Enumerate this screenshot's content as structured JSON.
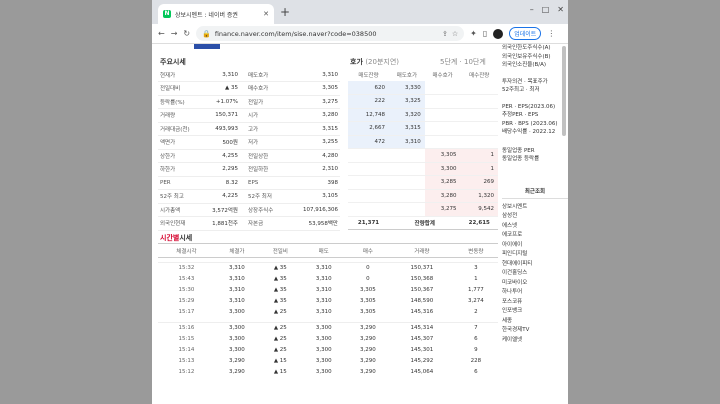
{
  "browser": {
    "tab_title": "상보시멘트 : 네이버 증권",
    "url": "finance.naver.com/item/sise.naver?code=038500",
    "update_label": "업데이트"
  },
  "quote_section": {
    "title": "주요시세",
    "rows": [
      {
        "l1": "현재가",
        "v1": "3,310",
        "c1": "",
        "l2": "매도호가",
        "v2": "3,310"
      },
      {
        "l1": "전일대비",
        "v1": "▲ 35",
        "c1": "red",
        "l2": "매수호가",
        "v2": "3,305"
      },
      {
        "l1": "등락률(%)",
        "v1": "+1.07%",
        "c1": "red",
        "l2": "전일가",
        "v2": "3,275"
      },
      {
        "l1": "거래량",
        "v1": "150,371",
        "c1": "",
        "l2": "시가",
        "v2": "3,280"
      },
      {
        "l1": "거래대금(천)",
        "v1": "493,993",
        "c1": "",
        "l2": "고가",
        "v2": "3,315"
      },
      {
        "l1": "액면가",
        "v1": "500원",
        "c1": "",
        "l2": "저가",
        "v2": "3,255"
      },
      {
        "l1": "상한가",
        "v1": "4,255",
        "c1": "",
        "l2": "전일상한",
        "v2": "4,280"
      },
      {
        "l1": "하한가",
        "v1": "2,295",
        "c1": "",
        "l2": "전일하한",
        "v2": "2,310"
      },
      {
        "l1": "PER",
        "v1": "8.32",
        "c1": "",
        "l2": "EPS",
        "v2": "398"
      },
      {
        "l1": "52주 최고",
        "v1": "4,225",
        "c1": "",
        "l2": "52주 최저",
        "v2": "3,105"
      },
      {
        "l1": "시가총액",
        "v1": "3,572억원",
        "c1": "",
        "l2": "상장주식수",
        "v2": "107,916,306"
      },
      {
        "l1": "외국인현재",
        "v1": "1,881천주",
        "c1": "",
        "l2": "자본금",
        "v2": "53,958백만"
      }
    ]
  },
  "hoga_section": {
    "title": "호가",
    "subtitle": "(20분지연)",
    "step_label": "5단계 · 10단계",
    "headers": [
      "매도잔량",
      "매도호가",
      "매수호가",
      "매수잔량"
    ],
    "asks": [
      {
        "qty": "620",
        "price": "3,330"
      },
      {
        "qty": "222",
        "price": "3,325"
      },
      {
        "qty": "12,748",
        "price": "3,320"
      },
      {
        "qty": "2,667",
        "price": "3,315"
      },
      {
        "qty": "472",
        "price": "3,310"
      }
    ],
    "bids": [
      {
        "price": "3,305",
        "qty": "1"
      },
      {
        "price": "3,300",
        "qty": "1"
      },
      {
        "price": "3,285",
        "qty": "269"
      },
      {
        "price": "3,280",
        "qty": "1,320"
      },
      {
        "price": "3,275",
        "qty": "9,542"
      }
    ],
    "sum_ask": "21,371",
    "sum_label": "잔량합계",
    "sum_bid": "22,615"
  },
  "time_section": {
    "title_red": "시간별",
    "title": "시세",
    "headers": [
      "체결시각",
      "체결가",
      "전일비",
      "매도",
      "매수",
      "거래량",
      "변동량"
    ],
    "groups": [
      [
        {
          "t": "15:32",
          "p": "3,310",
          "d": "▲ 35",
          "s": "3,310",
          "b": "0",
          "v": "150,371",
          "c": "3"
        },
        {
          "t": "15:43",
          "p": "3,310",
          "d": "▲ 35",
          "s": "3,310",
          "b": "0",
          "v": "150,368",
          "c": "1"
        },
        {
          "t": "15:30",
          "p": "3,310",
          "d": "▲ 35",
          "s": "3,310",
          "b": "3,305",
          "v": "150,367",
          "c": "1,777"
        },
        {
          "t": "15:29",
          "p": "3,310",
          "d": "▲ 35",
          "s": "3,310",
          "b": "3,305",
          "v": "148,590",
          "c": "3,274"
        },
        {
          "t": "15:17",
          "p": "3,300",
          "d": "▲ 25",
          "s": "3,310",
          "b": "3,305",
          "v": "145,316",
          "c": "2"
        }
      ],
      [
        {
          "t": "15:16",
          "p": "3,300",
          "d": "▲ 25",
          "s": "3,300",
          "b": "3,290",
          "v": "145,314",
          "c": "7"
        },
        {
          "t": "15:15",
          "p": "3,300",
          "d": "▲ 25",
          "s": "3,300",
          "b": "3,290",
          "v": "145,307",
          "c": "6"
        },
        {
          "t": "15:14",
          "p": "3,300",
          "d": "▲ 25",
          "s": "3,300",
          "b": "3,290",
          "v": "145,301",
          "c": "9"
        },
        {
          "t": "15:13",
          "p": "3,290",
          "d": "▲ 15",
          "s": "3,300",
          "b": "3,290",
          "v": "145,292",
          "c": "228"
        },
        {
          "t": "15:12",
          "p": "3,290",
          "d": "▲ 15",
          "s": "3,300",
          "b": "3,290",
          "v": "145,064",
          "c": "6"
        }
      ]
    ]
  },
  "sidebar": {
    "top_lines": [
      "외국인한도주식수(A)",
      "외국인보유주식수(B)",
      "외국인소진율(B/A)"
    ],
    "mid_lines": [
      "투자의견 · 목표주가",
      "52주최고 · 최저"
    ],
    "per_lines": [
      "PER · EPS(2023.06)",
      "추정PER · EPS",
      "PBR · BPS (2023.06)",
      "배당수익률 · 2022.12"
    ],
    "industry_lines": [
      "동일업종 PER",
      "동일업종 등락률"
    ],
    "recent_title": "최근조회",
    "recent_items": [
      "상보시멘트",
      "삼성전",
      "에스넷",
      "에코프로",
      "아이에이",
      "피인디지털",
      "현대에이피티",
      "이건홀딩스",
      "미코바이오",
      "하나투어",
      "포스코퓨",
      "인포뱅크",
      "세종",
      "한국경제TV",
      "케이엘넷"
    ]
  }
}
